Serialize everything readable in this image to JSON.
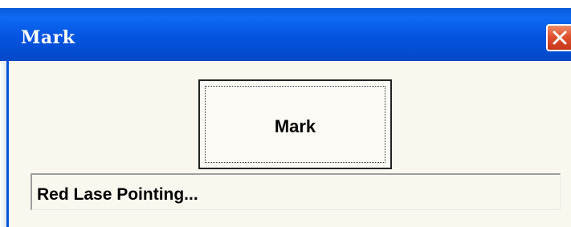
{
  "window": {
    "title": "Mark"
  },
  "main": {
    "mark_button_label": "Mark",
    "status_text": "Red Lase Pointing..."
  },
  "icons": {
    "close": "close-icon"
  },
  "colors": {
    "titlebar": "#0554e0",
    "close_button": "#e0512d",
    "client_background": "#faf8ee"
  }
}
